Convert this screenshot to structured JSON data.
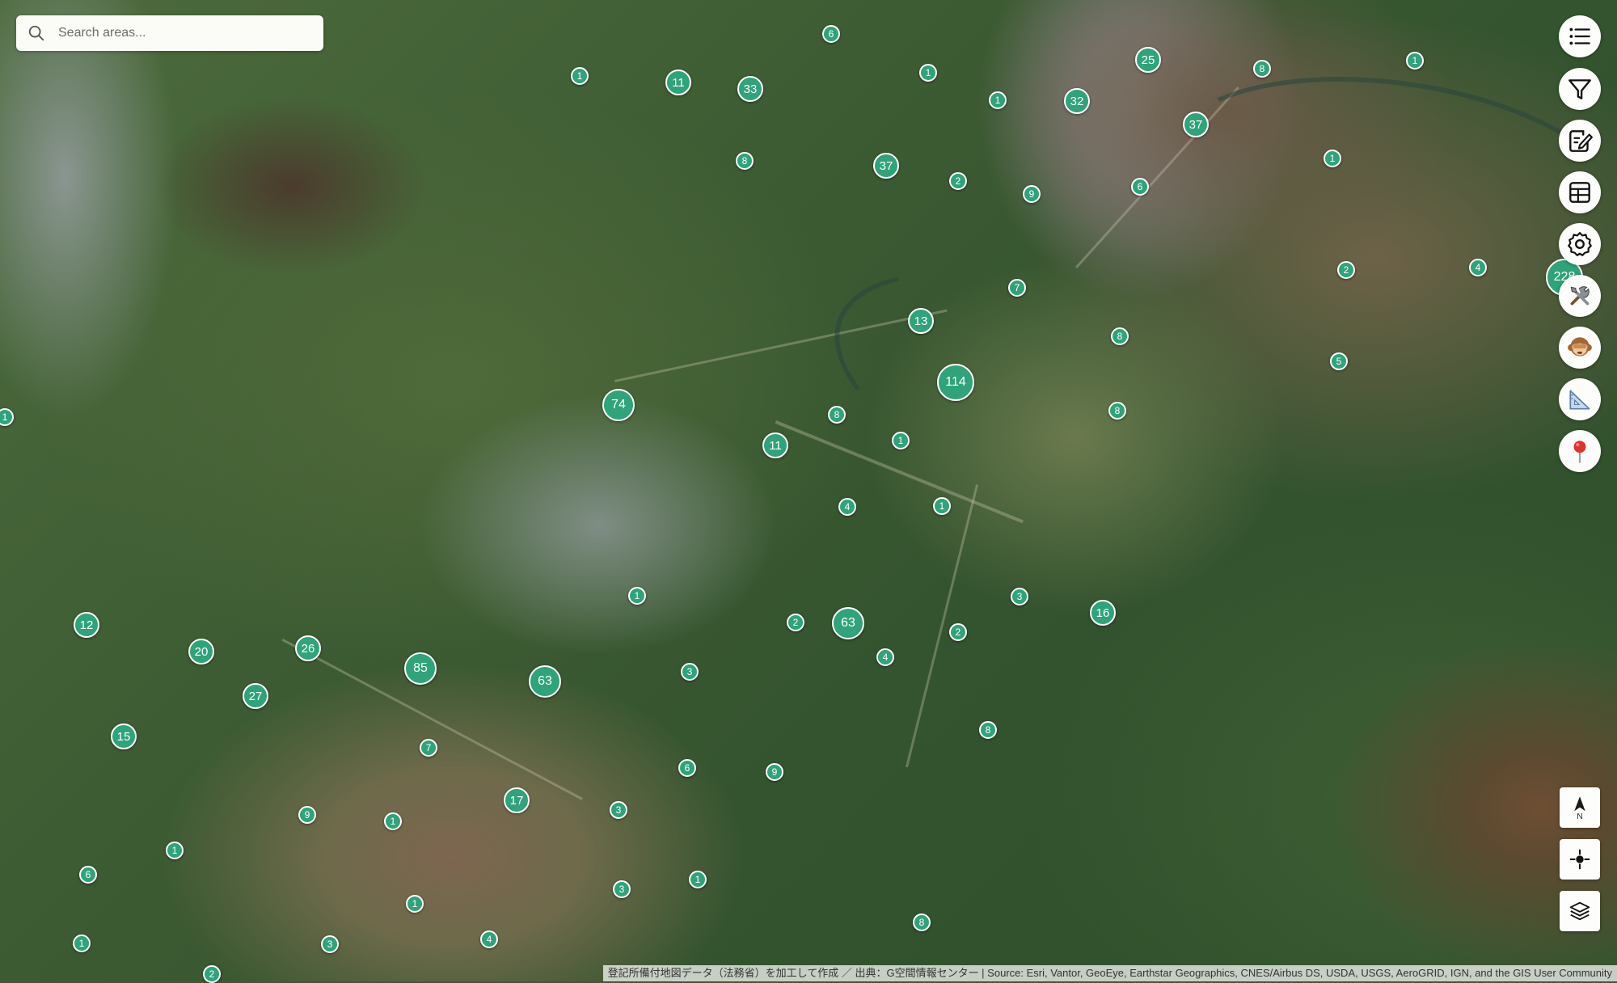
{
  "search": {
    "placeholder": "Search areas..."
  },
  "toolbar": [
    {
      "name": "list-icon"
    },
    {
      "name": "filter-icon"
    },
    {
      "name": "edit-note-icon"
    },
    {
      "name": "table-icon"
    },
    {
      "name": "settings-gear-icon"
    },
    {
      "name": "tools-icon"
    },
    {
      "name": "monkey-face-icon"
    },
    {
      "name": "ruler-triangle-icon"
    },
    {
      "name": "map-pin-icon"
    }
  ],
  "map_controls": {
    "north_label": "N"
  },
  "attribution": "登記所備付地図データ（法務省）を加工して作成 ／ 出典：G空間情報センター | Source: Esri, Vantor, GeoEye, Earthstar Geographics, CNES/Airbus DS, USDA, USGS, AeroGRID, IGN, and the GIS User Community",
  "colors": {
    "cluster_fill": "#2fa37a",
    "cluster_border": "#ffffff",
    "button_bg": "#fdfdfb"
  },
  "clusters": [
    "6",
    "1",
    "11",
    "33",
    "1",
    "1",
    "32",
    "25",
    "8",
    "37",
    "1",
    "8",
    "37",
    "2",
    "9",
    "6",
    "1",
    "7",
    "13",
    "8",
    "2",
    "4",
    "228",
    "74",
    "8",
    "11",
    "1",
    "114",
    "5",
    "8",
    "1",
    "4",
    "1",
    "63",
    "3",
    "16",
    "1",
    "3",
    "12",
    "20",
    "26",
    "85",
    "63",
    "2",
    "4",
    "2",
    "27",
    "15",
    "7",
    "8",
    "6",
    "9",
    "9",
    "17",
    "1",
    "3",
    "1",
    "6",
    "3",
    "1",
    "8",
    "1",
    "4",
    "3",
    "1",
    "2"
  ]
}
